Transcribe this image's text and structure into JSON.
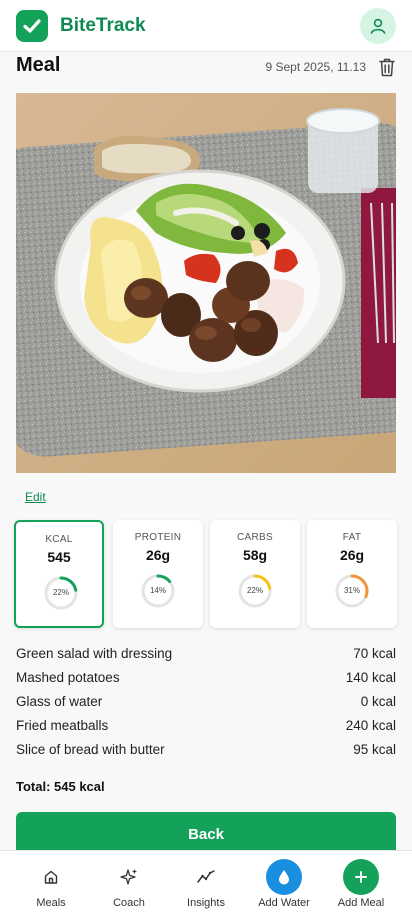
{
  "app": {
    "name": "BiteTrack",
    "accent": "#14a25a",
    "logo_icon": "checkmark-logo",
    "profile_icon": "user-icon"
  },
  "meal": {
    "title": "Meal",
    "timestamp": "9 Sept 2025, 11.13",
    "delete_icon": "trash-icon",
    "edit_label": "Edit"
  },
  "macros": [
    {
      "label": "KCAL",
      "value": "545",
      "percent": 22,
      "percent_label": "22%",
      "color": "#14a25a",
      "selected": true
    },
    {
      "label": "PROTEIN",
      "value": "26g",
      "percent": 14,
      "percent_label": "14%",
      "color": "#14a25a",
      "selected": false
    },
    {
      "label": "CARBS",
      "value": "58g",
      "percent": 22,
      "percent_label": "22%",
      "color": "#f2c318",
      "selected": false
    },
    {
      "label": "FAT",
      "value": "26g",
      "percent": 31,
      "percent_label": "31%",
      "color": "#f0953a",
      "selected": false
    }
  ],
  "items": [
    {
      "name": "Green salad with dressing",
      "kcal": "70 kcal"
    },
    {
      "name": "Mashed potatoes",
      "kcal": "140 kcal"
    },
    {
      "name": "Glass of water",
      "kcal": "0 kcal"
    },
    {
      "name": "Fried meatballs",
      "kcal": "240 kcal"
    },
    {
      "name": "Slice of bread with butter",
      "kcal": "95 kcal"
    }
  ],
  "total_label": "Total: 545 kcal",
  "back_label": "Back",
  "nav": [
    {
      "label": "Meals",
      "icon": "home-icon"
    },
    {
      "label": "Coach",
      "icon": "sparkles-icon"
    },
    {
      "label": "Insights",
      "icon": "trend-icon"
    },
    {
      "label": "Add Water",
      "icon": "water-drop-icon",
      "color": "#1a8fe0"
    },
    {
      "label": "Add Meal",
      "icon": "plus-icon",
      "color": "#14a25a"
    }
  ]
}
